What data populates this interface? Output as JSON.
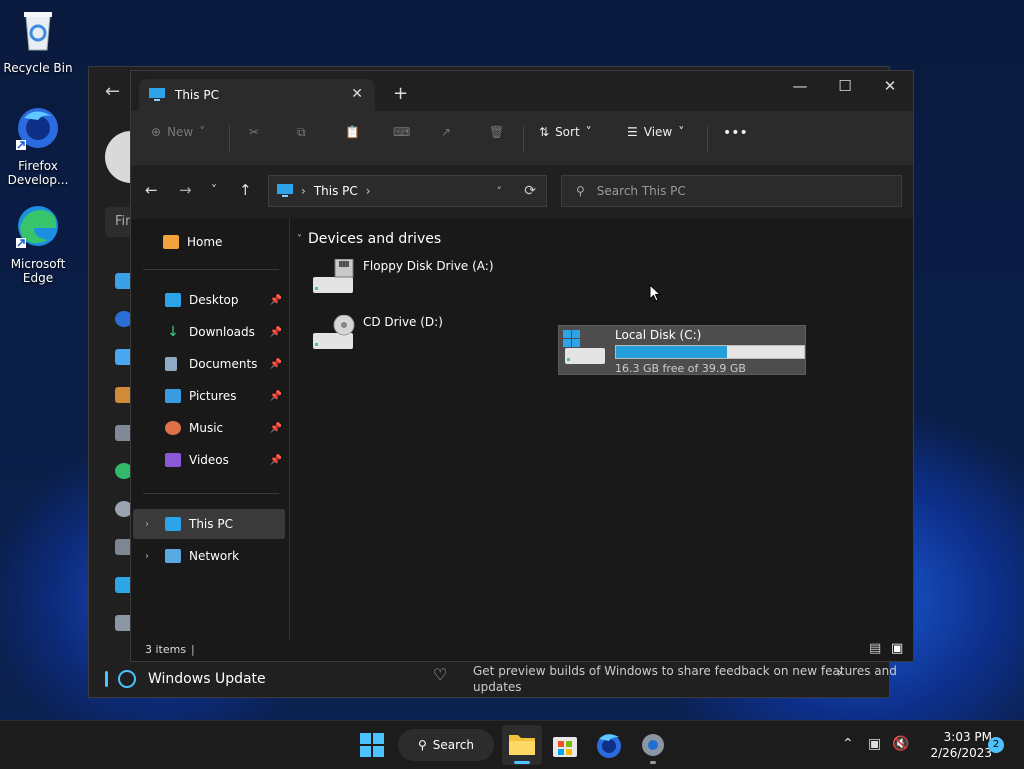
{
  "desktop": {
    "icons": [
      {
        "label": "Recycle Bin"
      },
      {
        "label": "Firefox Develop..."
      },
      {
        "label": "Microsoft Edge"
      }
    ]
  },
  "settings": {
    "search_placeholder": "Fin",
    "windows_update_label": "Windows Update",
    "insider_text": "Get preview builds of Windows to share feedback on new features and updates"
  },
  "explorer": {
    "tab_title": "This PC",
    "toolbar": {
      "new_label": "New",
      "sort_label": "Sort",
      "view_label": "View",
      "more_label": "•••"
    },
    "address": {
      "location": "This PC",
      "search_placeholder": "Search This PC"
    },
    "nav": {
      "home": "Home",
      "quick": [
        {
          "label": "Desktop"
        },
        {
          "label": "Downloads"
        },
        {
          "label": "Documents"
        },
        {
          "label": "Pictures"
        },
        {
          "label": "Music"
        },
        {
          "label": "Videos"
        }
      ],
      "this_pc": "This PC",
      "network": "Network"
    },
    "content": {
      "group_header": "Devices and drives",
      "drives": [
        {
          "name": "Floppy Disk Drive (A:)"
        },
        {
          "name": "CD Drive (D:)"
        },
        {
          "name": "Local Disk (C:)",
          "free_text": "16.3 GB free of 39.9 GB",
          "used_fraction": 0.59
        }
      ]
    },
    "status": {
      "items": "3 items"
    }
  },
  "taskbar": {
    "search_label": "Search",
    "time": "3:03 PM",
    "date": "2/26/2023",
    "notification_count": "2"
  },
  "colors": {
    "accent": "#4cc2ff",
    "drive_bar": "#26a0da",
    "selected_bg": "#3a3a3a"
  }
}
